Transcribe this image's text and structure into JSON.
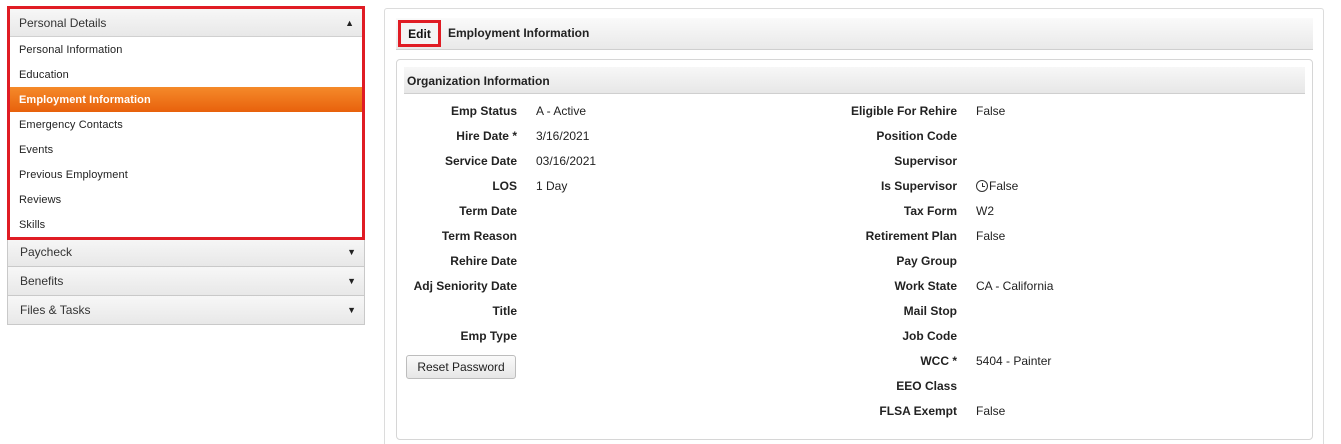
{
  "sidebar": {
    "expanded_group": {
      "label": "Personal Details",
      "items": [
        {
          "label": "Personal Information",
          "active": false
        },
        {
          "label": "Education",
          "active": false
        },
        {
          "label": "Employment Information",
          "active": true
        },
        {
          "label": "Emergency Contacts",
          "active": false
        },
        {
          "label": "Events",
          "active": false
        },
        {
          "label": "Previous Employment",
          "active": false
        },
        {
          "label": "Reviews",
          "active": false
        },
        {
          "label": "Skills",
          "active": false
        }
      ]
    },
    "collapsed_groups": [
      {
        "label": "Paycheck"
      },
      {
        "label": "Benefits"
      },
      {
        "label": "Files & Tasks"
      }
    ]
  },
  "toolbar": {
    "edit_label": "Edit",
    "title": "Employment Information"
  },
  "section": {
    "title": "Organization Information",
    "left_fields": [
      {
        "label": "Emp Status",
        "value": "A - Active"
      },
      {
        "label": "Hire Date *",
        "value": "3/16/2021"
      },
      {
        "label": "Service Date",
        "value": "03/16/2021"
      },
      {
        "label": "LOS",
        "value": "1 Day"
      },
      {
        "label": "Term Date",
        "value": ""
      },
      {
        "label": "Term Reason",
        "value": ""
      },
      {
        "label": "Rehire Date",
        "value": ""
      },
      {
        "label": "Adj Seniority Date",
        "value": ""
      },
      {
        "label": "Title",
        "value": ""
      },
      {
        "label": "Emp Type",
        "value": ""
      }
    ],
    "right_fields": [
      {
        "label": "Eligible For Rehire",
        "value": "False"
      },
      {
        "label": "Position Code",
        "value": ""
      },
      {
        "label": "Supervisor",
        "value": ""
      },
      {
        "label": "Is Supervisor",
        "value": "False",
        "icon": "clock-icon"
      },
      {
        "label": "Tax Form",
        "value": "W2"
      },
      {
        "label": "Retirement Plan",
        "value": "False"
      },
      {
        "label": "Pay Group",
        "value": ""
      },
      {
        "label": "Work State",
        "value": "CA - California"
      },
      {
        "label": "Mail Stop",
        "value": ""
      },
      {
        "label": "Job Code",
        "value": ""
      },
      {
        "label": "WCC *",
        "value": "5404 - Painter"
      },
      {
        "label": "EEO Class",
        "value": ""
      },
      {
        "label": "FLSA Exempt",
        "value": "False"
      }
    ],
    "reset_password_label": "Reset Password"
  },
  "colors": {
    "accent_orange": "#ef7519",
    "highlight_red": "#e01c24"
  }
}
